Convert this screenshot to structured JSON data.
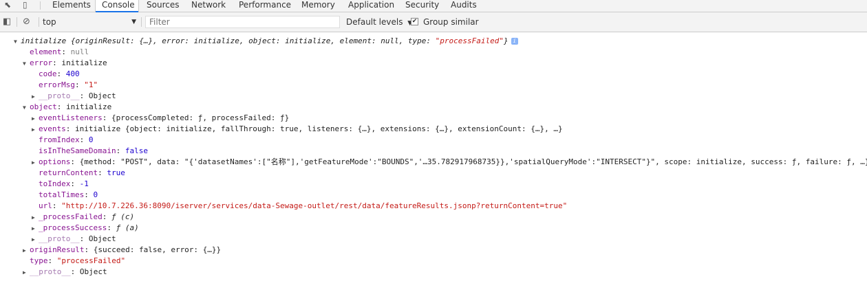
{
  "tabs": [
    "Elements",
    "Console",
    "Sources",
    "Network",
    "Performance",
    "Memory",
    "Application",
    "Security",
    "Audits"
  ],
  "active_tab": "Console",
  "toolbar": {
    "context": "top",
    "filter_placeholder": "Filter",
    "levels": "Default levels",
    "group_similar": "Group similar",
    "group_similar_checked": true
  },
  "console": {
    "root_name": "initialize",
    "root_preview_start": "{originResult: {…}, error: initialize, object: initialize, element: null, type: ",
    "root_type_value": "\"processFailed\"",
    "root_preview_end": "}",
    "element_key": "element",
    "element_value": "null",
    "error_key": "error",
    "error_value": "initialize",
    "code_key": "code",
    "code_value": "400",
    "errorMsg_key": "errorMsg",
    "errorMsg_value": "\"1\"",
    "proto_key": "__proto__",
    "proto_value": "Object",
    "object_key": "object",
    "object_value": "initialize",
    "eventListeners_key": "eventListeners",
    "eventListeners_value": "{processCompleted: ƒ, processFailed: ƒ}",
    "events_key": "events",
    "events_value": "initialize {object: initialize, fallThrough: true, listeners: {…}, extensions: {…}, extensionCount: {…}, …}",
    "fromIndex_key": "fromIndex",
    "fromIndex_value": "0",
    "isInTheSameDomain_key": "isInTheSameDomain",
    "isInTheSameDomain_value": "false",
    "options_key": "options",
    "options_value": "{method: \"POST\", data: \"{'datasetNames':[\"名称\"],'getFeatureMode':\"BOUNDS\",'…35.782917968735}},'spatialQueryMode':\"INTERSECT\"}\", scope: initialize, success: ƒ, failure: ƒ, …}",
    "returnContent_key": "returnContent",
    "returnContent_value": "true",
    "toIndex_key": "toIndex",
    "toIndex_value": "-1",
    "totalTimes_key": "totalTimes",
    "totalTimes_value": "0",
    "url_key": "url",
    "url_value": "\"http://10.7.226.36:8090/iserver/services/data-Sewage-outlet/rest/data/featureResults.jsonp?returnContent=true\"",
    "processFailed_key": "_processFailed",
    "processFailed_value": "ƒ (c)",
    "processSuccess_key": "_processSuccess",
    "processSuccess_value": "ƒ (a)",
    "originResult_key": "originResult",
    "originResult_value": "{succeed: false, error: {…}}",
    "type_key": "type",
    "type_value": "\"processFailed\""
  }
}
